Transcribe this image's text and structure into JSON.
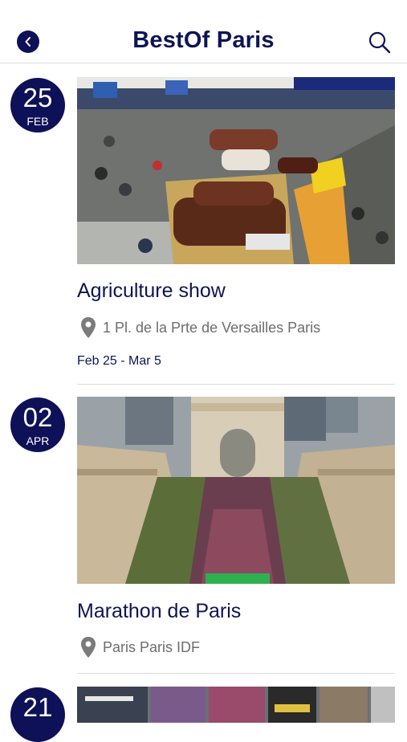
{
  "header": {
    "title": "BestOf Paris",
    "back_icon": "chevron-left-icon",
    "search_icon": "search-icon"
  },
  "colors": {
    "primary": "#0e1157",
    "muted": "#6d6d6d",
    "divider": "#dcdcdc"
  },
  "events": [
    {
      "day": "25",
      "month": "FEB",
      "title": "Agriculture show",
      "location": "1 Pl. de la Prte de Versailles Paris",
      "dates": "Feb 25 - Mar 5",
      "image": "livestock hall with cattle and crowd"
    },
    {
      "day": "02",
      "month": "APR",
      "title": "Marathon de Paris",
      "location": "Paris Paris IDF",
      "image": "runners on avenue with Arc de Triomphe"
    },
    {
      "day": "21",
      "image": "book covers"
    }
  ]
}
